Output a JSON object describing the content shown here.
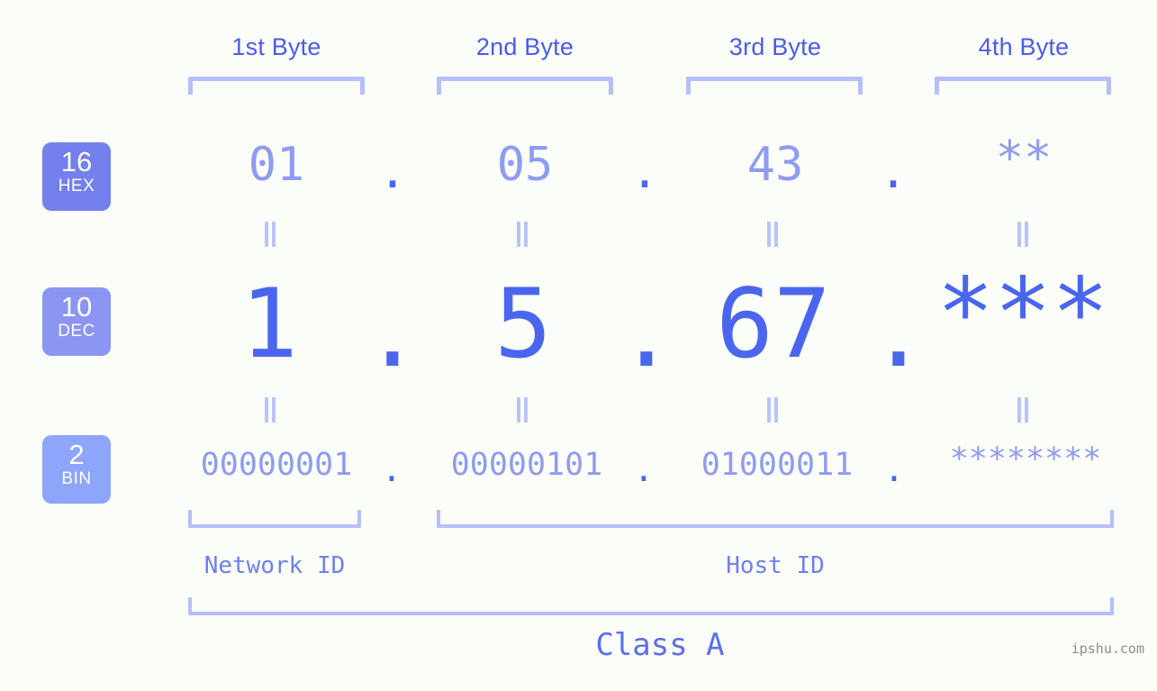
{
  "background_color": "#fbfdf9",
  "accent_colors": {
    "header_text": "#4a5ce8",
    "bracket": "#b4bffb",
    "hex_digits": "#8e9cf1",
    "dec_digits": "#4a66ee",
    "bin_digits": "#8e9cf1",
    "dot": "#4a66ee",
    "equals_mark": "#b9c3fb",
    "badge_hex": "#7380ee",
    "badge_dec": "#8b95f2",
    "badge_bin": "#8da5fa",
    "id_label": "#6f80ee",
    "class_label": "#5b6eee",
    "watermark": "#8c8c8c"
  },
  "byte_headers": [
    {
      "label": "1st Byte"
    },
    {
      "label": "2nd Byte"
    },
    {
      "label": "3rd Byte"
    },
    {
      "label": "4th Byte"
    }
  ],
  "bases": [
    {
      "number": "16",
      "name": "HEX"
    },
    {
      "number": "10",
      "name": "DEC"
    },
    {
      "number": "2",
      "name": "BIN"
    }
  ],
  "rows": {
    "hex": {
      "base_number": "16",
      "base_name": "HEX",
      "values": [
        "01",
        "05",
        "43",
        "**"
      ],
      "separators": [
        ".",
        ".",
        "."
      ]
    },
    "dec": {
      "base_number": "10",
      "base_name": "DEC",
      "values": [
        "1",
        "5",
        "67",
        "***"
      ],
      "separators": [
        ".",
        ".",
        "."
      ]
    },
    "bin": {
      "base_number": "2",
      "base_name": "BIN",
      "values": [
        "00000001",
        "00000101",
        "01000011",
        "********"
      ],
      "separators": [
        ".",
        ".",
        "."
      ]
    }
  },
  "equality_markers": {
    "glyph": "||",
    "count_per_row": 4,
    "rows": 2
  },
  "id_sections": [
    {
      "label": "Network ID"
    },
    {
      "label": "Host ID"
    }
  ],
  "class_section": {
    "label": "Class A"
  },
  "watermark": {
    "text": "ipshu.com"
  }
}
